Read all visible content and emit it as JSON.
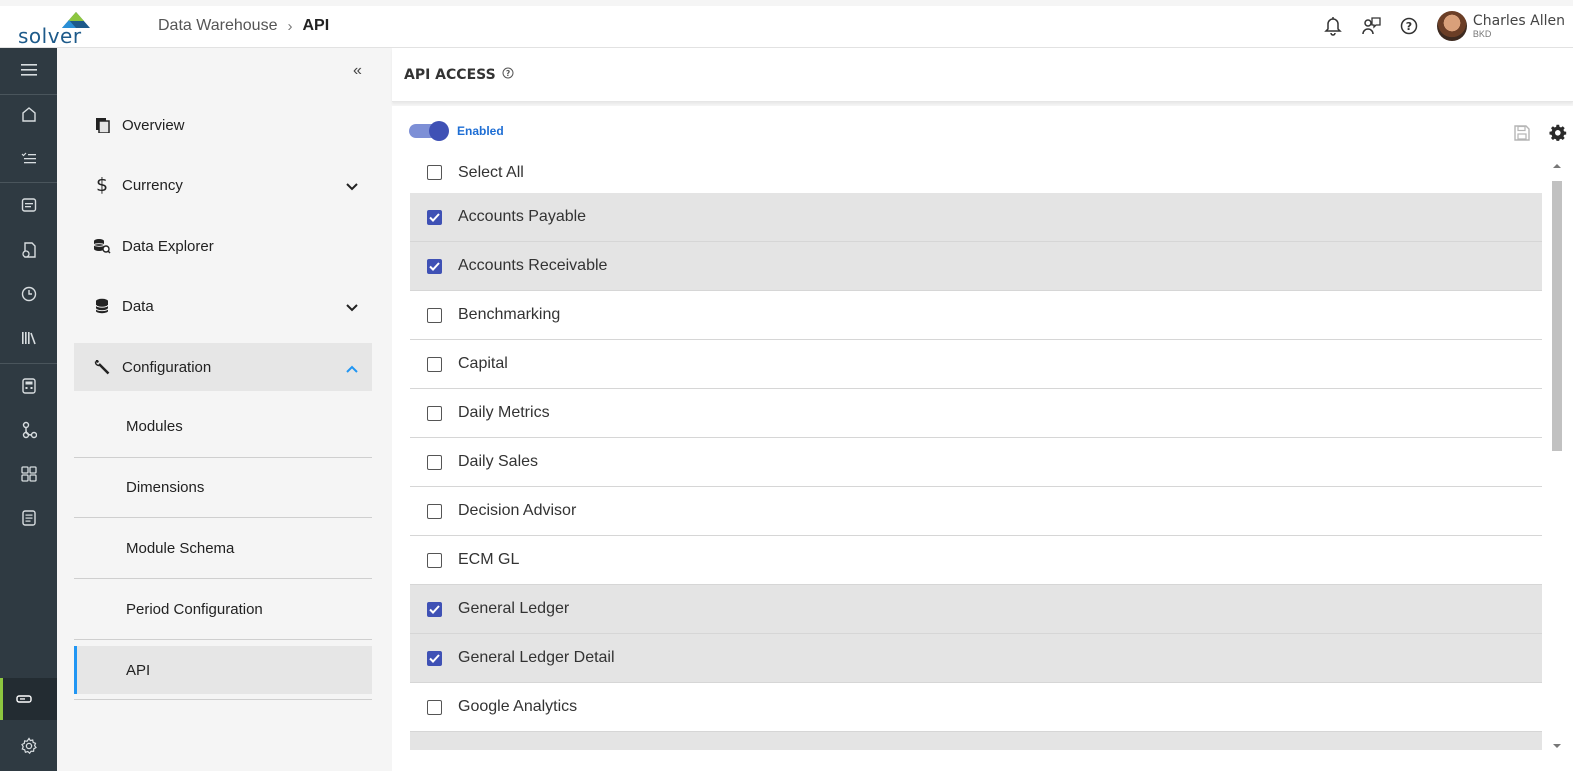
{
  "brand": {
    "logo_text": "solver"
  },
  "breadcrumb": {
    "parent": "Data Warehouse",
    "current": "API"
  },
  "user": {
    "name": "Charles Allen",
    "org": "BKD"
  },
  "icons": {
    "top": [
      "bell-icon",
      "chat-icon",
      "help-icon"
    ],
    "rail": [
      "menu-icon",
      "home-icon",
      "tasks-icon",
      "reports-icon",
      "forms-icon",
      "history-icon",
      "library-icon",
      "calculator-icon",
      "workflow-icon",
      "dashboard-icon",
      "documents-icon",
      "warehouse-icon",
      "settings-icon"
    ]
  },
  "nav": {
    "collapse_glyph": "«",
    "items": [
      {
        "label": "Overview",
        "icon": "overview-icon"
      },
      {
        "label": "Currency",
        "icon": "dollar-icon"
      },
      {
        "label": "Data Explorer",
        "icon": "data-explorer-icon"
      },
      {
        "label": "Data",
        "icon": "database-icon"
      },
      {
        "label": "Configuration",
        "icon": "wrench-icon"
      }
    ],
    "sub_items": [
      {
        "label": "Modules"
      },
      {
        "label": "Dimensions"
      },
      {
        "label": "Module Schema"
      },
      {
        "label": "Period Configuration"
      },
      {
        "label": "API"
      }
    ]
  },
  "content": {
    "title": "API ACCESS",
    "toggle_label": "Enabled",
    "toggle_on": true,
    "select_all_label": "Select All",
    "modules": [
      {
        "label": "Accounts Payable",
        "checked": true
      },
      {
        "label": "Accounts Receivable",
        "checked": true
      },
      {
        "label": "Benchmarking",
        "checked": false
      },
      {
        "label": "Capital",
        "checked": false
      },
      {
        "label": "Daily Metrics",
        "checked": false
      },
      {
        "label": "Daily Sales",
        "checked": false
      },
      {
        "label": "Decision Advisor",
        "checked": false
      },
      {
        "label": "ECM GL",
        "checked": false
      },
      {
        "label": "General Ledger",
        "checked": true
      },
      {
        "label": "General Ledger Detail",
        "checked": true
      },
      {
        "label": "Google Analytics",
        "checked": false
      }
    ]
  },
  "colors": {
    "accent": "#3f51b5",
    "rail": "#2f3a42",
    "active_rail": "#8dc63f",
    "link": "#1e6ed4"
  }
}
